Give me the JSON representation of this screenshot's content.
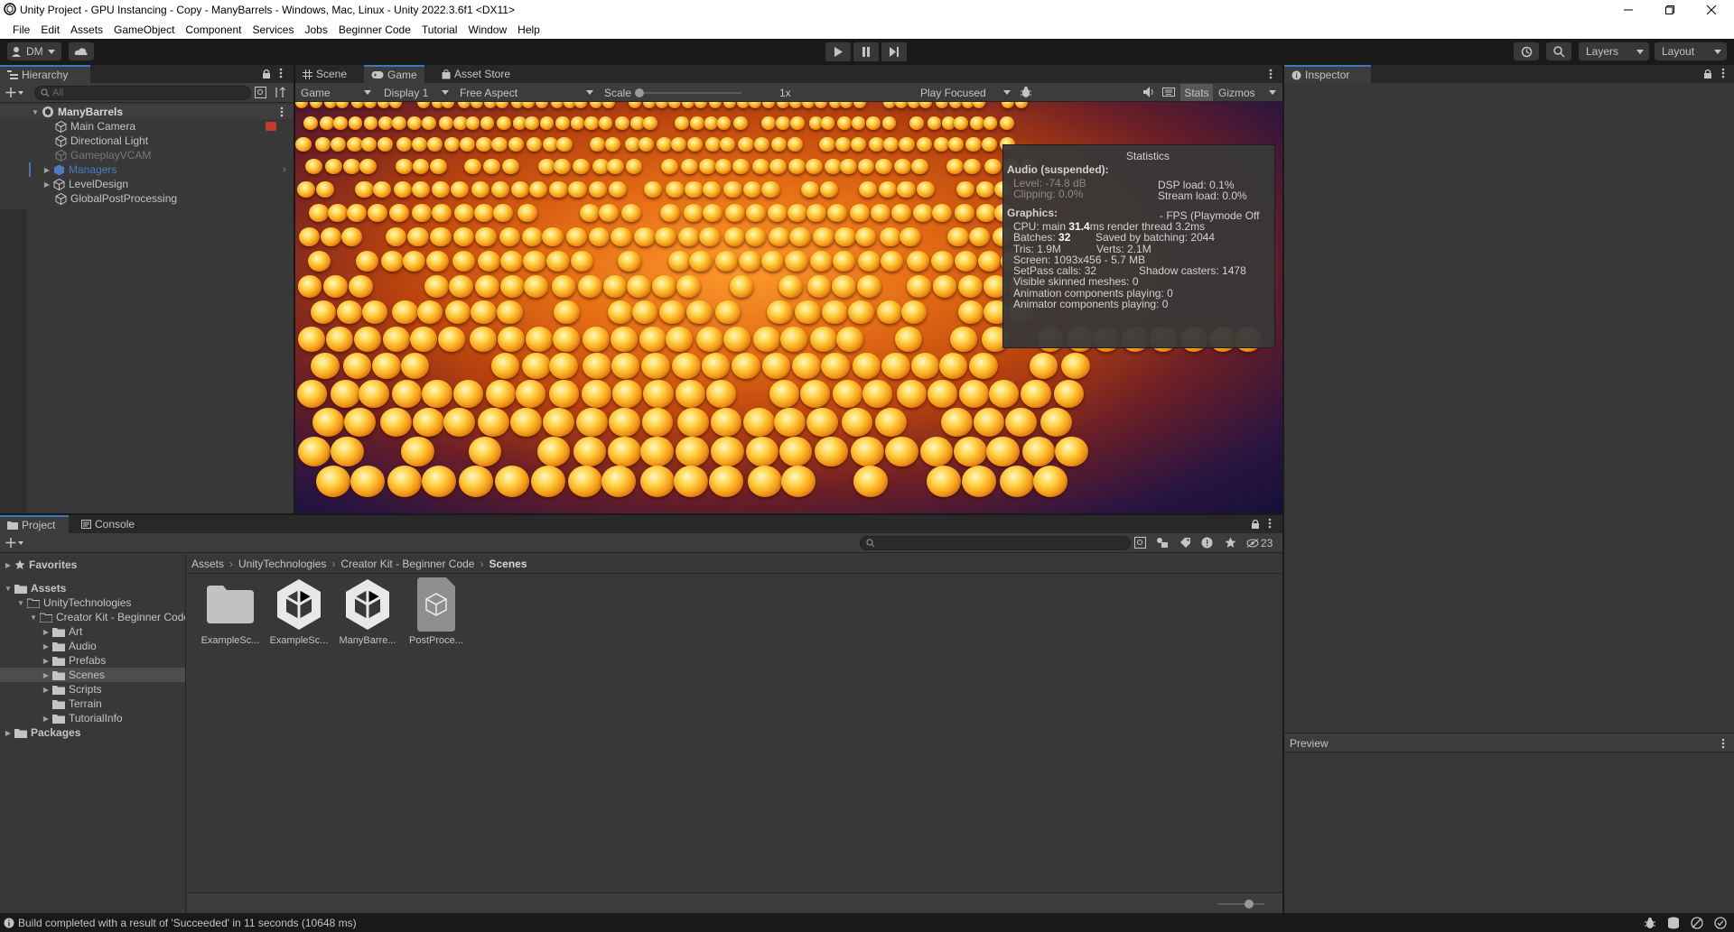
{
  "window": {
    "title": "Unity Project - GPU Instancing - Copy - ManyBarrels - Windows, Mac, Linux - Unity 2022.3.6f1 <DX11>"
  },
  "menu": [
    "File",
    "Edit",
    "Assets",
    "GameObject",
    "Component",
    "Services",
    "Jobs",
    "Beginner Code",
    "Tutorial",
    "Window",
    "Help"
  ],
  "toolbar": {
    "account": "DM",
    "layers": "Layers",
    "layout": "Layout"
  },
  "hierarchy": {
    "tab": "Hierarchy",
    "search_placeholder": "All",
    "scene": "ManyBarrels",
    "items": [
      {
        "label": "Main Camera"
      },
      {
        "label": "Directional Light"
      },
      {
        "label": "GameplayVCAM"
      },
      {
        "label": "Managers"
      },
      {
        "label": "LevelDesign"
      },
      {
        "label": "GlobalPostProcessing"
      }
    ]
  },
  "game": {
    "tabs": [
      "Scene",
      "Game",
      "Asset Store"
    ],
    "mode": "Game",
    "display": "Display 1",
    "aspect": "Free Aspect",
    "scale_label": "Scale",
    "scale_value": "1x",
    "play_focused": "Play Focused",
    "stats_label": "Stats",
    "gizmos_label": "Gizmos"
  },
  "stats": {
    "title": "Statistics",
    "audio_header": "Audio (suspended):",
    "level": "Level: -74.8 dB",
    "clipping": "Clipping: 0.0%",
    "dsp_load": "DSP load: 0.1%",
    "stream_load": "Stream load: 0.0%",
    "graphics_header": "Graphics:",
    "fps": "- FPS (Playmode Off",
    "cpu_prefix": "CPU: main ",
    "cpu_main": "31.4",
    "cpu_suffix": "ms  render thread 3.2ms",
    "batches_prefix": "Batches: ",
    "batches": "32",
    "saved_batching": "Saved by batching: 2044",
    "tris": "Tris: 1.9M",
    "verts": "Verts: 2.1M",
    "screen": "Screen: 1093x456 - 5.7 MB",
    "setpass": "SetPass calls: 32",
    "shadow_casters": "Shadow casters: 1478",
    "skinned": "Visible skinned meshes: 0",
    "animation": "Animation components playing: 0",
    "animator": "Animator components playing: 0"
  },
  "inspector": {
    "tab": "Inspector",
    "preview": "Preview"
  },
  "project": {
    "tabs": [
      "Project",
      "Console"
    ],
    "hidden_count": "23",
    "favorites": "Favorites",
    "tree": [
      {
        "label": "Assets",
        "bold": true
      },
      {
        "label": "UnityTechnologies"
      },
      {
        "label": "Creator Kit - Beginner Code"
      },
      {
        "label": "Art"
      },
      {
        "label": "Audio"
      },
      {
        "label": "Prefabs"
      },
      {
        "label": "Scenes"
      },
      {
        "label": "Scripts"
      },
      {
        "label": "Terrain"
      },
      {
        "label": "TutorialInfo"
      },
      {
        "label": "Packages",
        "bold": true
      }
    ],
    "breadcrumb": [
      "Assets",
      "UnityTechnologies",
      "Creator Kit - Beginner Code",
      "Scenes"
    ],
    "assets": [
      {
        "label": "ExampleSc...",
        "icon": "folder-icon"
      },
      {
        "label": "ExampleSc...",
        "icon": "unity-scene-icon"
      },
      {
        "label": "ManyBarre...",
        "icon": "unity-scene-icon"
      },
      {
        "label": "PostProce...",
        "icon": "asset-cube-icon"
      }
    ]
  },
  "status": {
    "message": "Build completed with a result of 'Succeeded' in 11 seconds (10648 ms)"
  },
  "colors": {
    "accent": "#3a79bb",
    "panel": "#383838",
    "dark": "#191919"
  }
}
